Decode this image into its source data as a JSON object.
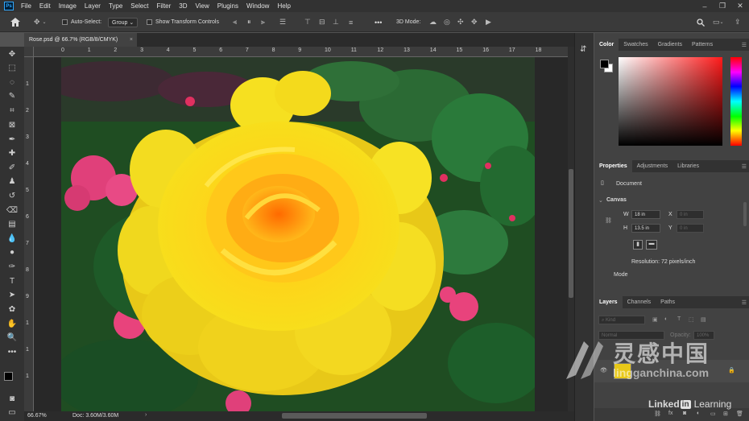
{
  "menubar": {
    "logo": "Ps",
    "items": [
      "File",
      "Edit",
      "Image",
      "Layer",
      "Type",
      "Select",
      "Filter",
      "3D",
      "View",
      "Plugins",
      "Window",
      "Help"
    ]
  },
  "options": {
    "auto_select_label": "Auto-Select:",
    "auto_select_value": "Group",
    "show_transform_label": "Show Transform Controls",
    "more": "•••",
    "mode_3d_label": "3D Mode:"
  },
  "document": {
    "tab_title": "Rose.psd @ 66.7% (RGB/8/CMYK)",
    "close": "×"
  },
  "ruler": {
    "top": [
      "0",
      "1",
      "2",
      "3",
      "4",
      "5",
      "6",
      "7",
      "8",
      "9",
      "10",
      "11",
      "12",
      "13",
      "14",
      "15",
      "16",
      "17",
      "18"
    ],
    "left": [
      "1",
      "2",
      "3",
      "4",
      "5",
      "6",
      "7",
      "8",
      "9",
      "1",
      "1",
      "1"
    ]
  },
  "status": {
    "zoom": "66.67%",
    "doc": "Doc: 3.60M/3.60M"
  },
  "color_panel": {
    "tabs": [
      "Color",
      "Swatches",
      "Gradients",
      "Patterns"
    ],
    "foreground": "#000000",
    "background": "#ffffff",
    "hue": "#ff2020"
  },
  "properties": {
    "tabs": [
      "Properties",
      "Adjustments",
      "Libraries"
    ],
    "type": "Document",
    "section": "Canvas",
    "w_label": "W",
    "w_value": "18 in",
    "h_label": "H",
    "h_value": "13.5 in",
    "x_label": "X",
    "x_value": "0 in",
    "y_label": "Y",
    "y_value": "0 in",
    "resolution": "Resolution: 72 pixels/inch",
    "mode_label": "Mode"
  },
  "layers": {
    "tabs": [
      "Layers",
      "Channels",
      "Paths"
    ],
    "kind": "Kind",
    "blend": "Normal",
    "opacity_label": "Opacity:",
    "opacity_value": "100%"
  },
  "watermark": {
    "cn_text": "灵感中国",
    "url": "lingganchina.com",
    "linkedin": "Linked",
    "in": "in",
    "learning": "Learning"
  },
  "icons": [
    "home-icon",
    "move-icon",
    "align-left-icon",
    "align-center-icon",
    "more-icon",
    "orbit-icon",
    "search-icon",
    "workspace-icon",
    "share-icon"
  ]
}
